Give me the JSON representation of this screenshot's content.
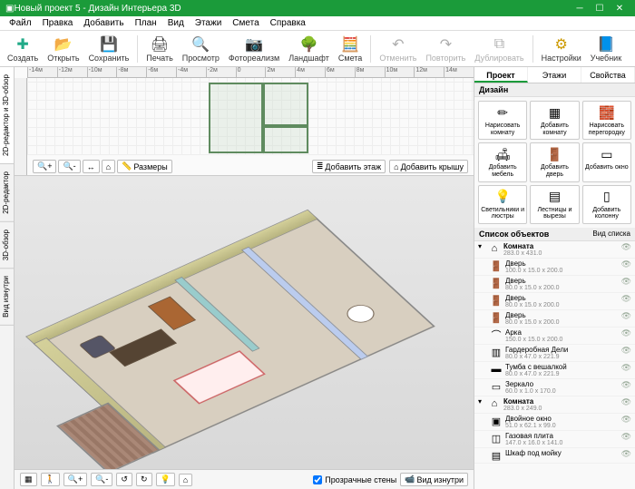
{
  "window": {
    "title": "Новый проект 5 - Дизайн Интерьера 3D"
  },
  "menu": [
    "Файл",
    "Правка",
    "Добавить",
    "План",
    "Вид",
    "Этажи",
    "Смета",
    "Справка"
  ],
  "toolbar": {
    "create": "Создать",
    "open": "Открыть",
    "save": "Сохранить",
    "print": "Печать",
    "preview": "Просмотр",
    "photo": "Фотореализм",
    "landscape": "Ландшафт",
    "estimate": "Смета",
    "undo": "Отменить",
    "redo": "Повторить",
    "duplicate": "Дублировать",
    "settings": "Настройки",
    "tutorial": "Учебник"
  },
  "ruler": [
    "-14м",
    "-12м",
    "-10м",
    "-8м",
    "-6м",
    "-4м",
    "-2м",
    "0",
    "2м",
    "4м",
    "6м",
    "8м",
    "10м",
    "12м",
    "14м"
  ],
  "ctrls2d": {
    "dims": "Размеры",
    "add_floor": "Добавить этаж",
    "add_roof": "Добавить крышу"
  },
  "bottom": {
    "transp": "Прозрачные стены",
    "inside": "Вид изнутри"
  },
  "vtabs": [
    "2D-редактор и 3D-обзор",
    "2D-редактор",
    "3D-обзор",
    "Вид изнутри"
  ],
  "rtabs": {
    "project": "Проект",
    "floors": "Этажи",
    "props": "Свойства"
  },
  "design": {
    "header": "Дизайн",
    "btns": [
      {
        "n": "draw-room",
        "l": "Нарисовать комнату"
      },
      {
        "n": "add-room",
        "l": "Добавить комнату"
      },
      {
        "n": "draw-partition",
        "l": "Нарисовать перегородку"
      },
      {
        "n": "add-furniture",
        "l": "Добавить мебель"
      },
      {
        "n": "add-door",
        "l": "Добавить дверь"
      },
      {
        "n": "add-window",
        "l": "Добавить окно"
      },
      {
        "n": "add-lights",
        "l": "Светильники и люстры"
      },
      {
        "n": "add-stairs",
        "l": "Лестницы и вырезы"
      },
      {
        "n": "add-column",
        "l": "Добавить колонну"
      }
    ]
  },
  "objects": {
    "header": "Список объектов",
    "view_list": "Вид списка",
    "items": [
      {
        "t": "group",
        "name": "Комната",
        "dim": "283.0 x 431.0",
        "open": true
      },
      {
        "t": "child",
        "ic": "door",
        "name": "Дверь",
        "dim": "100.0 x 15.0 x 200.0"
      },
      {
        "t": "child",
        "ic": "door",
        "name": "Дверь",
        "dim": "80.0 x 15.0 x 200.0"
      },
      {
        "t": "child",
        "ic": "door",
        "name": "Дверь",
        "dim": "80.0 x 15.0 x 200.0"
      },
      {
        "t": "child",
        "ic": "door",
        "name": "Дверь",
        "dim": "80.0 x 15.0 x 200.0"
      },
      {
        "t": "child",
        "ic": "arch",
        "name": "Арка",
        "dim": "150.0 x 15.0 x 200.0"
      },
      {
        "t": "child",
        "ic": "wardrobe",
        "name": "Гардеробная Дели",
        "dim": "80.0 x 47.0 x 221.9"
      },
      {
        "t": "child",
        "ic": "stand",
        "name": "Тумба с вешалкой",
        "dim": "80.0 x 47.0 x 221.9"
      },
      {
        "t": "child",
        "ic": "mirror",
        "name": "Зеркало",
        "dim": "60.0 x 1.0 x 170.0"
      },
      {
        "t": "group",
        "name": "Комната",
        "dim": "283.0 x 249.0",
        "open": true
      },
      {
        "t": "child",
        "ic": "window",
        "name": "Двойное окно",
        "dim": "51.0 x 62.1 x 99.0"
      },
      {
        "t": "child",
        "ic": "stove",
        "name": "Газовая плита",
        "dim": "147.0 x 16.0 x 141.0"
      },
      {
        "t": "child",
        "ic": "cabinet",
        "name": "Шкаф под мойку",
        "dim": ""
      }
    ]
  }
}
